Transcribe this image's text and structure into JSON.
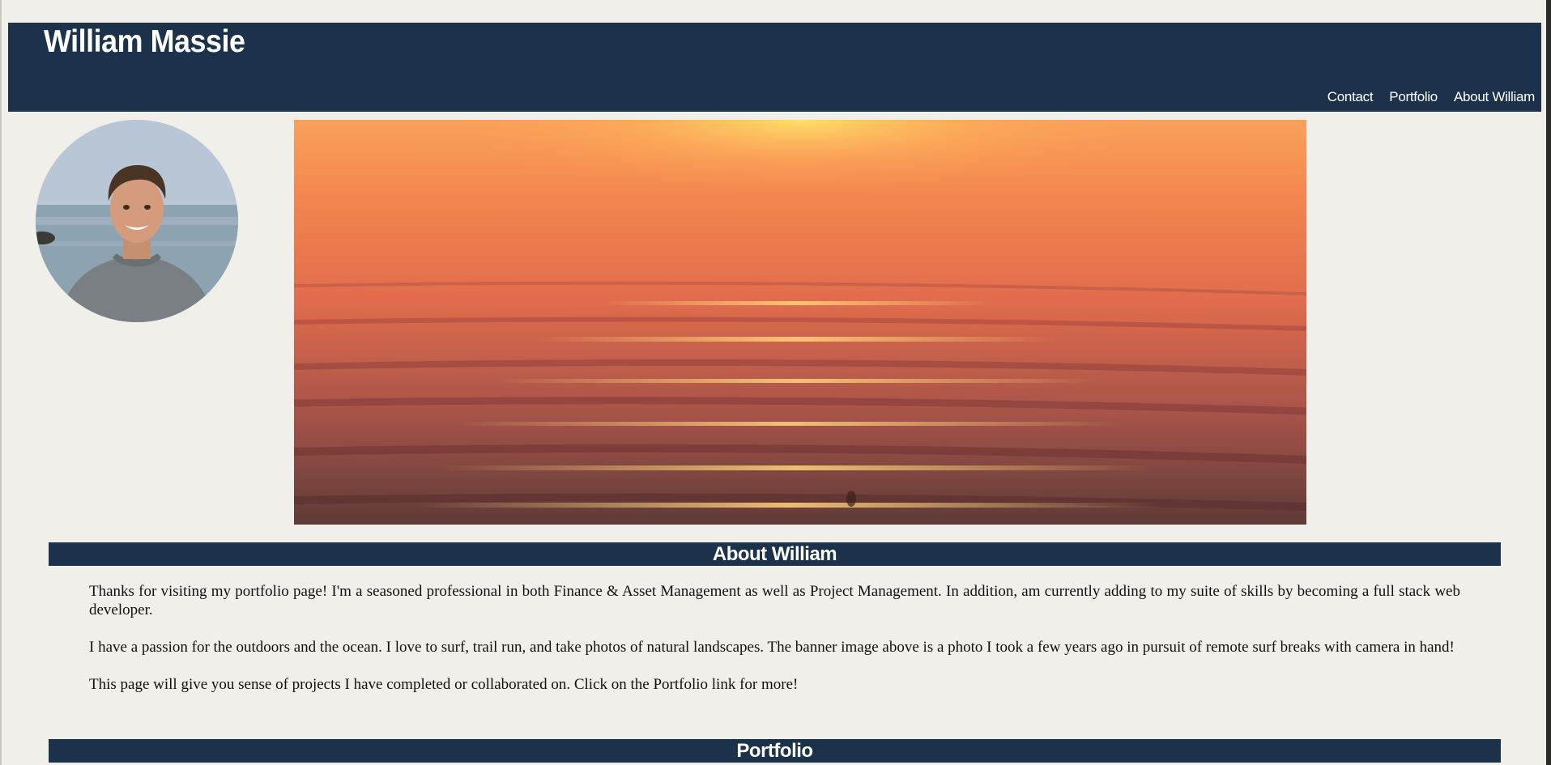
{
  "header": {
    "title": "William Massie",
    "nav": [
      {
        "label": "Contact"
      },
      {
        "label": "Portfolio"
      },
      {
        "label": "About William"
      }
    ]
  },
  "about": {
    "heading": "About William",
    "paragraphs": [
      "Thanks for visiting my portfolio page! I'm a seasoned professional in both Finance & Asset Management as well as Project Management. In addition, am currently adding to my suite of skills by becoming a full stack web developer.",
      "I have a passion for the outdoors and the ocean. I love to surf, trail run, and take photos of natural landscapes. The banner image above is a photo I took a few years ago in pursuit of remote surf breaks with camera in hand!",
      "This page will give you sense of projects I have completed or collaborated on. Click on the Portfolio link for more!"
    ]
  },
  "portfolio": {
    "heading": "Portfolio"
  },
  "colors": {
    "header_bg": "#1b324a",
    "page_bg": "#f0efe9",
    "header_text": "#ffffff"
  }
}
